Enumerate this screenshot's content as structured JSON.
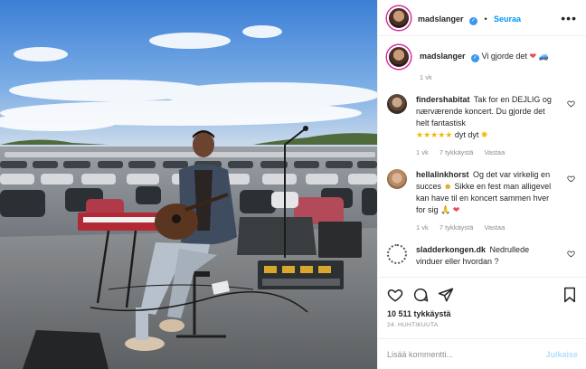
{
  "post": {
    "author": "madslanger",
    "follow_label": "Seuraa",
    "more_icon": "more-options-icon",
    "caption": {
      "username": "madslanger",
      "text": "Vi gjorde det",
      "emojis": [
        "heart-emoji",
        "car-emoji"
      ],
      "time": "1 vk"
    }
  },
  "comments": [
    {
      "username": "findershabitat",
      "text": "Tak for en DEJLIG og nærværende koncert. Du gjorde det helt fantastisk",
      "trailing": "dyt dyt",
      "emojis": [
        "star-emoji",
        "star-emoji",
        "star-emoji",
        "star-emoji",
        "star-emoji",
        "sun-emoji"
      ],
      "time": "1 vk",
      "likes": "7 tykkäystä",
      "reply_label": "Vastaa"
    },
    {
      "username": "hellalinkhorst",
      "text": "Og det var virkelig en succes",
      "text2": "Sikke en fest man alligevel kan have til en koncert sammen hver for sig",
      "time": "1 vk",
      "likes": "7 tykkäystä",
      "reply_label": "Vastaa"
    },
    {
      "username": "sladderkongen.dk",
      "text": "Nedrullede vinduer eller hvordan ?"
    }
  ],
  "actions": {
    "like_icon": "heart-outline-icon",
    "comment_icon": "comment-icon",
    "share_icon": "share-icon",
    "save_icon": "bookmark-icon",
    "likes_count": "10 511 tykkäystä",
    "date": "24. HUHTIKUUTA"
  },
  "add_comment": {
    "placeholder": "Lisää kommentti...",
    "post_label": "Julkaise"
  },
  "colors": {
    "link_blue": "#0095f6",
    "verified_blue": "#3897f0",
    "muted_gray": "#8e8e8e",
    "heart_red": "#ed4956"
  }
}
